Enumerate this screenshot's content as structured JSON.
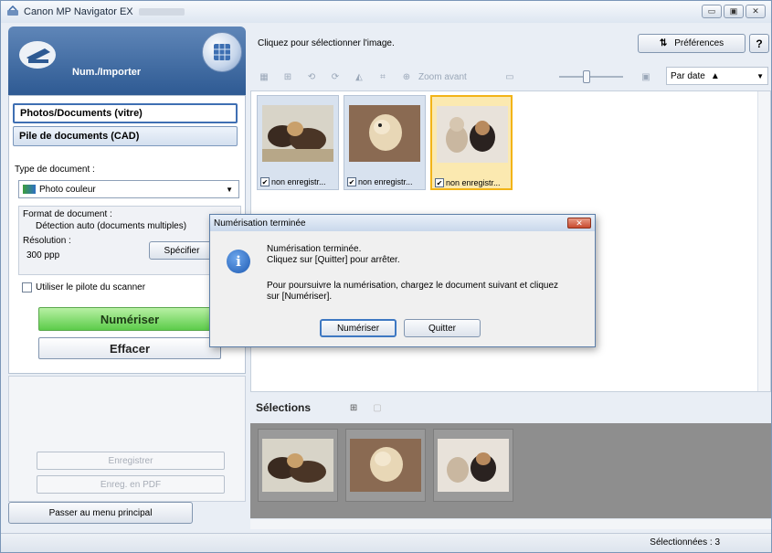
{
  "window": {
    "title": "Canon MP Navigator EX",
    "min_glyph": "▭",
    "max_glyph": "▣",
    "close_glyph": "✕"
  },
  "left": {
    "header_label": "Num./Importer",
    "source_selected": "Photos/Documents (vitre)",
    "source_other": "Pile de documents (CAD)",
    "doc_type_label": "Type de document :",
    "doc_type_value": "Photo couleur",
    "doc_format_label": "Format de document :",
    "doc_format_value": "Détection auto (documents multiples)",
    "resolution_label": "Résolution :",
    "resolution_value": "300 ppp",
    "specify_button": "Spécifier",
    "use_driver_label": "Utiliser le pilote du scanner",
    "scan_button": "Numériser",
    "clear_button": "Effacer",
    "save_button": "Enregistrer",
    "save_pdf_button": "Enreg. en PDF",
    "main_menu_button": "Passer au menu principal"
  },
  "right": {
    "hint": "Cliquez pour sélectionner l'image.",
    "preferences_button": "Préférences",
    "help_button": "?",
    "zoom_label": "Zoom avant",
    "sort_value": "Par date",
    "thumbnails": [
      {
        "caption": "non enregistr...",
        "selected": false
      },
      {
        "caption": "non enregistr...",
        "selected": false
      },
      {
        "caption": "non enregistr...",
        "selected": true
      }
    ],
    "selections_title": "Sélections"
  },
  "status": {
    "selected_text": "Sélectionnées : 3"
  },
  "dialog": {
    "title": "Numérisation terminée",
    "line1": "Numérisation terminée.",
    "line2": "Cliquez sur [Quitter] pour arrêter.",
    "line3": "Pour poursuivre la numérisation, chargez le document suivant et cliquez",
    "line4": "sur [Numériser].",
    "scan_button": "Numériser",
    "quit_button": "Quitter"
  },
  "colors": {
    "accent": "#2e5a93",
    "scan_green": "#5ccc4a",
    "selection_gold": "#f2b417"
  }
}
